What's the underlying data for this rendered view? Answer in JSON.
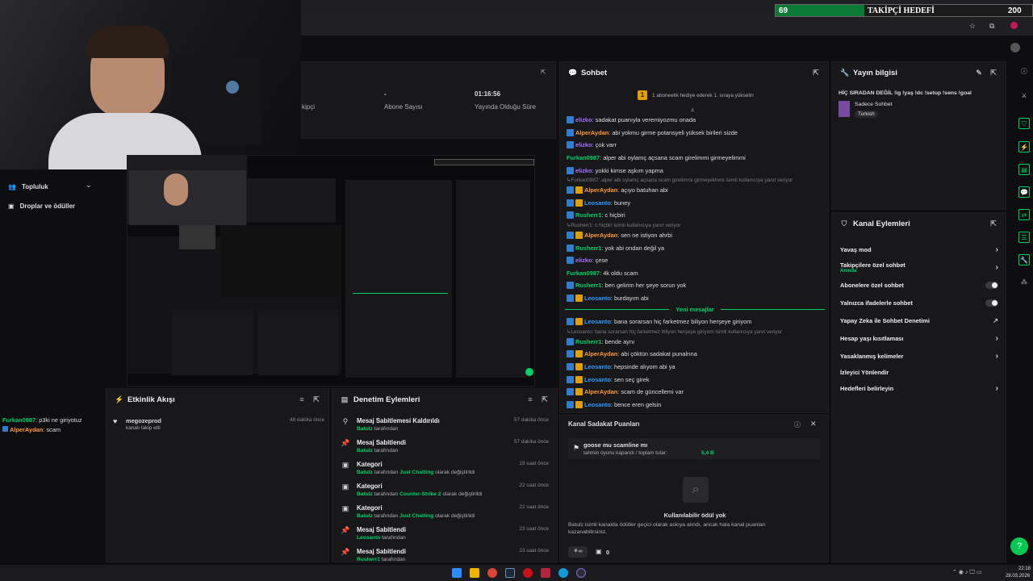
{
  "goal_bar": {
    "count": "69",
    "label": "TAKİPÇİ HEDEFİ",
    "target": "200"
  },
  "stats": {
    "partial_label": "kipçi",
    "sub_value": "-",
    "sub_label": "Abone Sayısı",
    "uptime_value": "01:16:56",
    "uptime_label": "Yayında Olduğu Süre"
  },
  "sidebar": {
    "community": "Topluluk",
    "drops": "Droplar ve ödüller"
  },
  "mini_chat": [
    {
      "user": "Furkan0987",
      "text": ": p3ki ne giriyotuz",
      "color": "#00d26a"
    },
    {
      "user": "AlperAydan",
      "text": ": scam",
      "color": "#ff9a3d"
    }
  ],
  "activity": {
    "title": "Etkinlik Akışı",
    "items": [
      {
        "user": "megozeprod",
        "action": "kanalı takip etti",
        "time": "48 dakika önce"
      }
    ]
  },
  "modlog": {
    "title": "Denetim Eylemleri",
    "items": [
      {
        "icon": "unpin-icon",
        "title": "Mesaj Sabitlemesi Kaldırıldı",
        "actor": "Batulz",
        "suffix": "tarafından",
        "time": "57 dakika önce"
      },
      {
        "icon": "pin-icon",
        "title": "Mesaj Sabitlendi",
        "actor": "Batulz",
        "suffix": "tarafından",
        "time": "57 dakika önce"
      },
      {
        "icon": "category-icon",
        "title": "Kategori",
        "actor": "Batulz",
        "mid": "tarafından",
        "cat": "Just Chatting",
        "suffix": "olarak değiştirildi",
        "time": "19 saat önce"
      },
      {
        "icon": "category-icon",
        "title": "Kategori",
        "actor": "Batulz",
        "mid": "tarafından",
        "cat": "Counter-Strike 2",
        "suffix": "olarak değiştirildi",
        "time": "22 saat önce"
      },
      {
        "icon": "category-icon",
        "title": "Kategori",
        "actor": "Batulz",
        "mid": "tarafından",
        "cat": "Just Chatting",
        "suffix": "olarak değiştirildi",
        "time": "22 saat önce"
      },
      {
        "icon": "pin-icon",
        "title": "Mesaj Sabitlendi",
        "actor": "Leosanto",
        "suffix": "tarafından",
        "time": "23 saat önce"
      },
      {
        "icon": "pin-icon",
        "title": "Mesaj Sabitlendi",
        "actor": "Rusherr1",
        "suffix": "tarafından",
        "time": "23 saat önce"
      }
    ]
  },
  "chat": {
    "title": "Sohbet",
    "hype": "1 aboneelik hediye ederek 1. sıraya yükselin",
    "new_messages": "Yeni mesajlar",
    "messages": [
      {
        "b": "1",
        "user": "elizko",
        "color": "#a970ff",
        "text": ": sadakat puanıyla veremiyozmu onada"
      },
      {
        "b": "1",
        "user": "AlperAydan",
        "color": "#ff9a3d",
        "text": ": abi yokmu girme potansyeli yüksek birileri sizde"
      },
      {
        "b": "1",
        "user": "elizko",
        "color": "#a970ff",
        "text": ": çok varr"
      },
      {
        "b": "0",
        "user": "Furkan0987",
        "color": "#00d26a",
        "text": ": alper abi oylamç açsana scam girelimmi girmeyelimmi"
      },
      {
        "b": "1",
        "user": "elizko",
        "color": "#a970ff",
        "text": ": yokki kimse aşkım yapma"
      },
      {
        "reply": "Furkan0987: alper abi oylamç açsana scam girelimmi girmeyelimmi isimli kullanıcıya yanıt veriyor"
      },
      {
        "b": "2",
        "user": "AlperAydan",
        "color": "#ff9a3d",
        "text": ": açıyo batuhan abi"
      },
      {
        "b": "2",
        "user": "Leosanto",
        "color": "#2e9bff",
        "text": ": buney"
      },
      {
        "b": "1",
        "user": "Rusherr1",
        "color": "#00d26a",
        "text": ": c hiçbiri"
      },
      {
        "reply": "Rusherr1: c hiçbiri isimli kullanıcıya yanıt veriyor"
      },
      {
        "b": "2",
        "user": "AlperAydan",
        "color": "#ff9a3d",
        "text": ": sen ne istiyon ahrbi"
      },
      {
        "b": "1",
        "user": "Rusherr1",
        "color": "#00d26a",
        "text": ": yok abi ondan değil ya"
      },
      {
        "b": "1",
        "user": "elizko",
        "color": "#a970ff",
        "text": ": çese"
      },
      {
        "b": "0",
        "user": "Furkan0987",
        "color": "#00d26a",
        "text": ": 4k oldu scam"
      },
      {
        "b": "1",
        "user": "Rusherr1",
        "color": "#00d26a",
        "text": ": ben gelirim her şeye sorun yok"
      },
      {
        "b": "2",
        "user": "Leosanto",
        "color": "#2e9bff",
        "text": ": burdayım abi"
      }
    ],
    "messages2": [
      {
        "b": "2",
        "user": "Leosanto",
        "color": "#2e9bff",
        "text": ": bana sorarsan hiç farketmez biliyon herşeye giriyom"
      },
      {
        "reply": "Leosanto: bana sorarsan hiç farketmez biliyon herşeye giriyom isimli kullanıcıya yanıt veriyor"
      },
      {
        "b": "1",
        "user": "Rusherr1",
        "color": "#00d26a",
        "text": ": bende aynı"
      },
      {
        "b": "2",
        "user": "AlperAydan",
        "color": "#ff9a3d",
        "text": ": abi çöktün sadakat punalrına"
      },
      {
        "b": "2",
        "user": "Leosanto",
        "color": "#2e9bff",
        "text": ": hepsinde alıyom abi ya"
      },
      {
        "b": "2",
        "user": "Leosanto",
        "color": "#2e9bff",
        "text": ": sen seç girek"
      },
      {
        "b": "2",
        "user": "AlperAydan",
        "color": "#ff9a3d",
        "text": ": scam de güncellemi var"
      },
      {
        "b": "2",
        "user": "Leosanto",
        "color": "#2e9bff",
        "text": ": bence eren gelsin"
      }
    ]
  },
  "loyalty": {
    "title": "Kanal Sadakat Puanları",
    "pred_title": "goose mu scamline mı",
    "pred_sub": "tahmin oyunu kapandı / toplam tutar:",
    "pred_amount": "5,4 B",
    "empty_title": "Kullanılabilir ödül yok",
    "empty_desc": "Batulz isimli kanalda ödüller geçici olarak askıya alındı, ancak hala kanal puanları kazanabilirsiniz.",
    "points": "0"
  },
  "stream_info": {
    "title": "Yayın bilgisi",
    "stream_title": "HİÇ SIRADAN DEĞİL !ig !yaş !dc !setup !sens !goal",
    "category": "Sadece Sohbet",
    "tag": "Turkish"
  },
  "channel_actions": {
    "title": "Kanal Eylemleri",
    "items": [
      {
        "label": "Yavaş mod",
        "ctrl": "chevron"
      },
      {
        "label": "Takipçilere özel sohbet",
        "sub": "Anında",
        "ctrl": "chevron"
      },
      {
        "label": "Abonelere özel sohbet",
        "ctrl": "toggle"
      },
      {
        "label": "Yalnızca ifadelerle sohbet",
        "ctrl": "toggle"
      },
      {
        "label": "Yapay Zeka ile Sohbet Denetimi",
        "ctrl": "external"
      },
      {
        "label": "Hesap yaşı kısıtlaması",
        "ctrl": "chevron"
      },
      {
        "label": "Yasaklanmış kelimeler",
        "ctrl": "chevron"
      },
      {
        "label": "İzleyici Yönlendir",
        "ctrl": "none"
      },
      {
        "label": "Hedefleri belirleyin",
        "ctrl": "chevron"
      }
    ]
  },
  "clock": {
    "time": "22:18",
    "date": "28.03.2026"
  }
}
